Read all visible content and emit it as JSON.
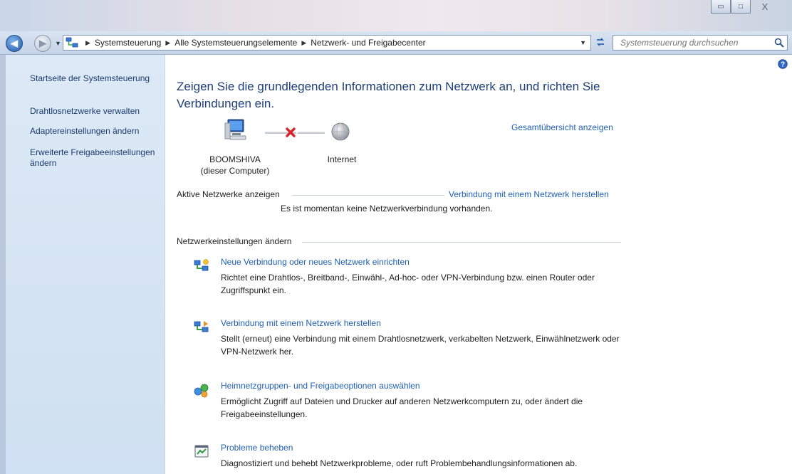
{
  "window": {
    "minimize_glyph": "▭",
    "maximize_glyph": "□",
    "close_glyph": "X"
  },
  "nav": {
    "back_glyph": "◀",
    "forward_glyph": "▶",
    "breadcrumbs": [
      "Systemsteuerung",
      "Alle Systemsteuerungselemente",
      "Netzwerk- und Freigabecenter"
    ],
    "search_placeholder": "Systemsteuerung durchsuchen"
  },
  "sidebar": {
    "items": [
      {
        "label": "Startseite der Systemsteuerung"
      },
      {
        "label": "Drahtlosnetzwerke verwalten"
      },
      {
        "label": "Adaptereinstellungen ändern"
      },
      {
        "label": "Erweiterte Freigabeeinstellungen ändern"
      }
    ]
  },
  "main": {
    "title": "Zeigen Sie die grundlegenden Informationen zum Netzwerk an, und richten Sie Verbindungen ein.",
    "full_map_link": "Gesamtübersicht anzeigen",
    "computer_name": "BOOMSHIVA",
    "computer_sub": "(dieser Computer)",
    "internet_label": "Internet",
    "active_networks": {
      "heading": "Aktive Netzwerke anzeigen",
      "link": "Verbindung mit einem Netzwerk herstellen",
      "status": "Es ist momentan keine Netzwerkverbindung vorhanden."
    },
    "change_settings": {
      "heading": "Netzwerkeinstellungen ändern",
      "tasks": [
        {
          "link": "Neue Verbindung oder neues Netzwerk einrichten",
          "desc": "Richtet eine Drahtlos-, Breitband-, Einwähl-, Ad-hoc- oder VPN-Verbindung bzw. einen Router oder Zugriffspunkt ein.",
          "icon": "network-setup-icon"
        },
        {
          "link": "Verbindung mit einem Netzwerk herstellen",
          "desc": "Stellt (erneut) eine Verbindung mit einem Drahtlosnetzwerk, verkabelten Netzwerk, Einwählnetzwerk oder VPN-Netzwerk her.",
          "icon": "network-connect-icon"
        },
        {
          "link": "Heimnetzgruppen- und Freigabeoptionen auswählen",
          "desc": "Ermöglicht Zugriff auf Dateien und Drucker auf anderen Netzwerkcomputern zu, oder ändert die Freigabeeinstellungen.",
          "icon": "homegroup-icon"
        },
        {
          "link": "Probleme beheben",
          "desc": "Diagnostiziert und behebt Netzwerkprobleme, oder ruft Problembehandlungsinformationen ab.",
          "icon": "troubleshoot-icon"
        }
      ]
    }
  },
  "colors": {
    "link": "#1f5fb3",
    "title": "#1e3f77",
    "sidebar_link": "#1a3c6e",
    "disconnected_x": "#d8232a"
  }
}
